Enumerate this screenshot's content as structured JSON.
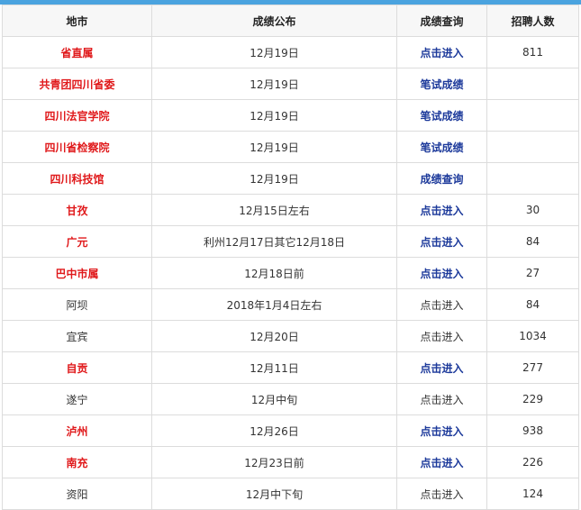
{
  "colors": {
    "accent_bar": "#4aa3df",
    "highlight_text": "#e0191b",
    "link_text": "#1d3a9b",
    "normal_text": "#333333"
  },
  "header": {
    "location": "地市",
    "publish": "成绩公布",
    "query": "成绩查询",
    "recruit": "招聘人数"
  },
  "rows": [
    {
      "location": "省直属",
      "publish": "12月19日",
      "query": "点击进入",
      "recruit": "811",
      "highlight": true
    },
    {
      "location": "共青团四川省委",
      "publish": "12月19日",
      "query": "笔试成绩",
      "recruit": "",
      "highlight": true
    },
    {
      "location": "四川法官学院",
      "publish": "12月19日",
      "query": "笔试成绩",
      "recruit": "",
      "highlight": true
    },
    {
      "location": "四川省检察院",
      "publish": "12月19日",
      "query": "笔试成绩",
      "recruit": "",
      "highlight": true
    },
    {
      "location": "四川科技馆",
      "publish": "12月19日",
      "query": "成绩查询",
      "recruit": "",
      "highlight": true
    },
    {
      "location": "甘孜",
      "publish": "12月15日左右",
      "query": "点击进入",
      "recruit": "30",
      "highlight": true
    },
    {
      "location": "广元",
      "publish": "利州12月17日其它12月18日",
      "query": "点击进入",
      "recruit": "84",
      "highlight": true
    },
    {
      "location": "巴中市属",
      "publish": "12月18日前",
      "query": "点击进入",
      "recruit": "27",
      "highlight": true
    },
    {
      "location": "阿坝",
      "publish": "2018年1月4日左右",
      "query": "点击进入",
      "recruit": "84",
      "highlight": false
    },
    {
      "location": "宜宾",
      "publish": "12月20日",
      "query": "点击进入",
      "recruit": "1034",
      "highlight": false
    },
    {
      "location": "自贡",
      "publish": "12月11日",
      "query": "点击进入",
      "recruit": "277",
      "highlight": true
    },
    {
      "location": "遂宁",
      "publish": "12月中旬",
      "query": "点击进入",
      "recruit": "229",
      "highlight": false
    },
    {
      "location": "泸州",
      "publish": "12月26日",
      "query": "点击进入",
      "recruit": "938",
      "highlight": true
    },
    {
      "location": "南充",
      "publish": "12月23日前",
      "query": "点击进入",
      "recruit": "226",
      "highlight": true
    },
    {
      "location": "资阳",
      "publish": "12月中下旬",
      "query": "点击进入",
      "recruit": "124",
      "highlight": false
    }
  ]
}
